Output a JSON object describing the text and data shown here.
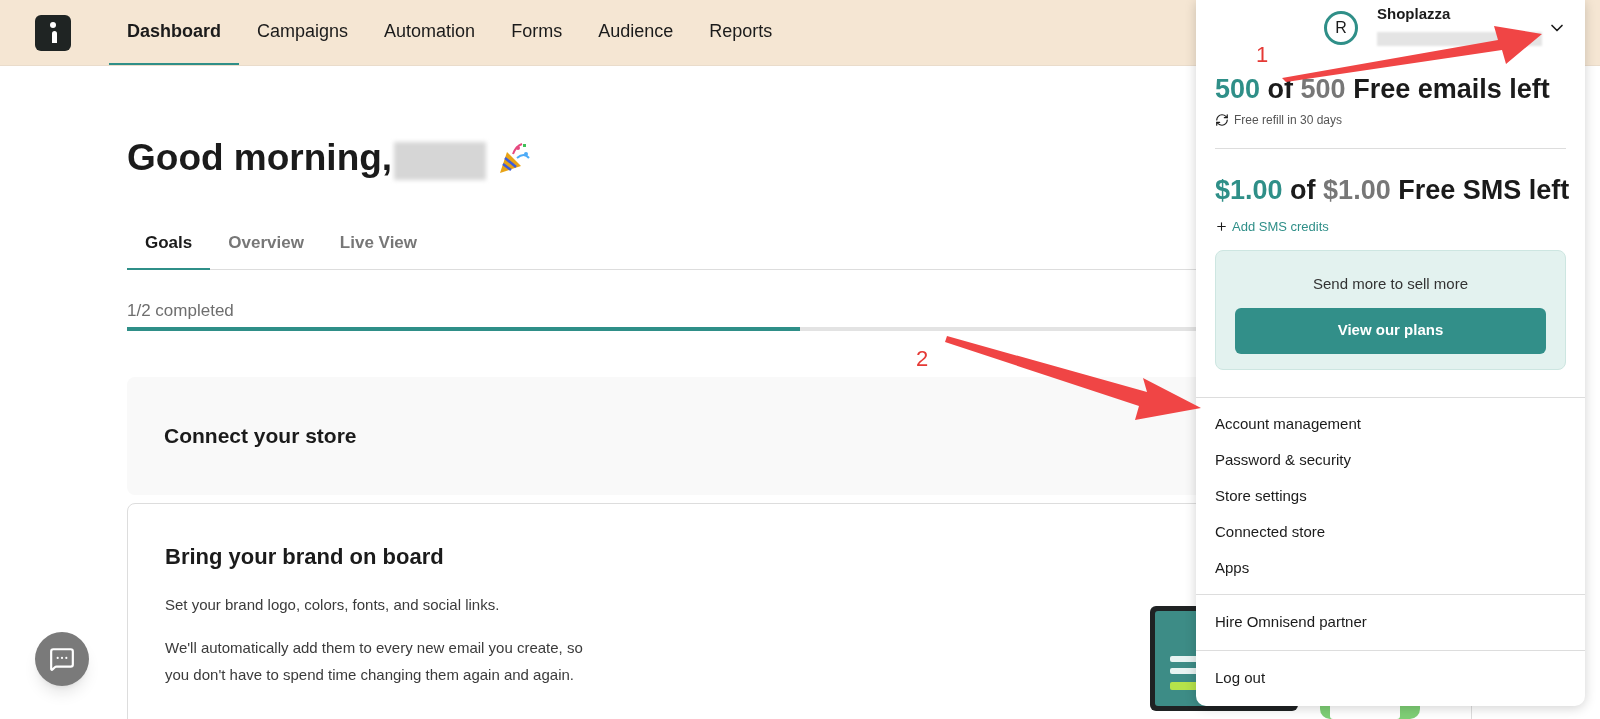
{
  "nav": {
    "items": [
      {
        "label": "Dashboard",
        "selected": true
      },
      {
        "label": "Campaigns",
        "selected": false
      },
      {
        "label": "Automation",
        "selected": false
      },
      {
        "label": "Forms",
        "selected": false
      },
      {
        "label": "Audience",
        "selected": false
      },
      {
        "label": "Reports",
        "selected": false
      }
    ]
  },
  "greeting": "Good morning,",
  "tabs": [
    {
      "label": "Goals",
      "selected": true
    },
    {
      "label": "Overview",
      "selected": false
    },
    {
      "label": "Live View",
      "selected": false
    }
  ],
  "progress": {
    "label": "1/2 completed",
    "level": 0.5
  },
  "cards": [
    {
      "title": "Connect your store"
    },
    {
      "title": "Bring your brand on board",
      "paragraphs": [
        "Set your brand logo, colors, fonts, and social links.",
        "We'll automatically add them to every new email you create, so you don't have to spend time changing them again and again."
      ]
    }
  ],
  "account_menu": {
    "avatar": "R",
    "store": "Shoplazza",
    "emails": {
      "remaining": "500",
      "of": "of",
      "total": "500",
      "label": "Free emails left",
      "note": "Free refill in 30 days"
    },
    "sms": {
      "remaining": "$1.00",
      "of": "of",
      "total": "$1.00",
      "label": "Free SMS left",
      "link": "Add SMS credits"
    },
    "promo": {
      "text": "Send more to sell more",
      "button": "View our plans"
    },
    "menu_groups": [
      [
        "Account management",
        "Password & security",
        "Store settings",
        "Connected store",
        "Apps"
      ],
      [
        "Hire Omnisend partner"
      ],
      [
        "Log out"
      ]
    ]
  },
  "annotations": [
    {
      "label": "1"
    },
    {
      "label": "2"
    }
  ]
}
